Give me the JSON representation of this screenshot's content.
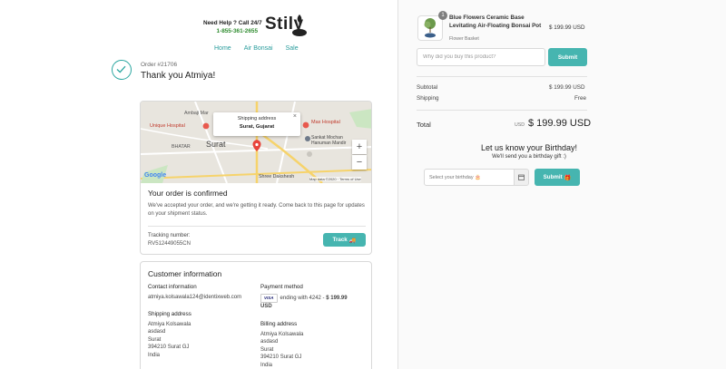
{
  "header": {
    "help_text": "Need Help ? Call 24/7",
    "phone": "1-855-361-2655",
    "logo": "Stily",
    "nav": [
      "Home",
      "Air Bonsai",
      "Sale"
    ]
  },
  "order": {
    "number": "Order #21706",
    "thanks": "Thank you Atmiya!"
  },
  "map": {
    "popup_title": "Shipping address",
    "popup_value": "Surat, Gujarat",
    "close": "×",
    "labels": {
      "ambaji": "Ambaji Mar",
      "unique": "Unique Hospital",
      "max": "Max Hospital",
      "bhatar": "BHATAR",
      "surat": "Surat",
      "sankat": "Sankat Mochan\nHanuman Mandir",
      "shree": "Shree Dakshesh",
      "google": "Google",
      "footer": "Map data ©2020 · Terms of Use"
    },
    "zoom_in": "+",
    "zoom_out": "−"
  },
  "confirmation": {
    "title": "Your order is confirmed",
    "body": "We've accepted your order, and we're getting it ready. Come back to this page for updates on your shipment status.",
    "tracking_label": "Tracking number:",
    "tracking_number": "RV512449055CN",
    "track_button": "Track"
  },
  "customer": {
    "title": "Customer information",
    "contact_label": "Contact information",
    "email": "atmiya.kolsawala124@identixweb.com",
    "payment_label": "Payment method",
    "card_brand": "VISA",
    "payment_text": "ending with 4242 -",
    "payment_amount": "$ 199.99",
    "payment_currency": "USD",
    "shipping_label": "Shipping address",
    "shipping_lines": [
      "Atmiya Kolsawala",
      "asdasd",
      "Surat",
      "394210 Surat GJ",
      "India"
    ],
    "billing_label": "Billing address",
    "billing_lines": [
      "Atmiya Kolsawala",
      "asdasd",
      "Surat",
      "394210 Surat GJ",
      "India"
    ]
  },
  "summary": {
    "qty": "1",
    "product_name": "Blue Flowers Ceramic Base Levitating Air-Floating Bonsai Pot",
    "variant": "Flower Basket",
    "product_price": "$ 199.99 USD",
    "why_placeholder": "Why did you buy this product?",
    "submit": "Submit",
    "subtotal_label": "Subtotal",
    "subtotal": "$ 199.99 USD",
    "shipping_label": "Shipping",
    "shipping": "Free",
    "total_label": "Total",
    "total_currency": "USD",
    "total": "$ 199.99 USD"
  },
  "birthday": {
    "title": "Let us know your Birthday!",
    "subtitle": "We'll send you a birthday gift :)",
    "placeholder": "Select your birthday 🎂",
    "submit": "Submit"
  },
  "colors": {
    "accent": "#46b5b0",
    "link": "#2a9d9d",
    "phone": "#2e8b2e"
  }
}
